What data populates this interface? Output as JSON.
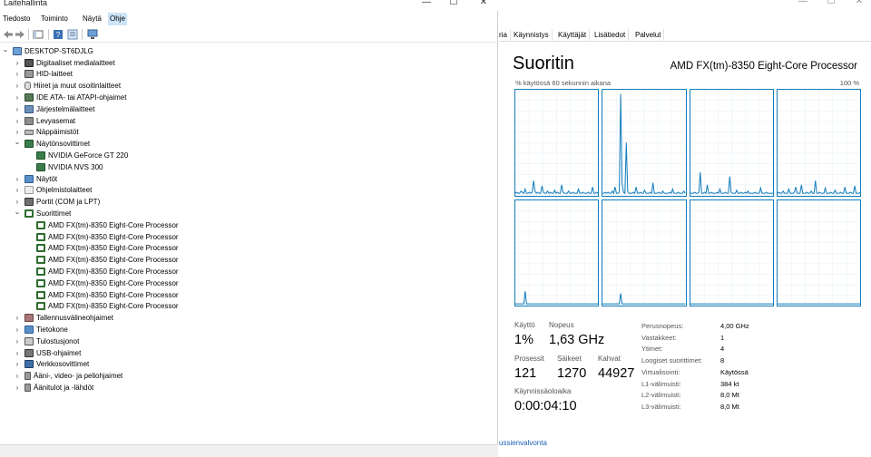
{
  "devmgr": {
    "title": "Laitehallinta",
    "menu": [
      "Tiedosto",
      "Toiminto",
      "Näytä",
      "Ohje"
    ],
    "tree": [
      {
        "label": "DESKTOP-ST6DJLG",
        "level": 0,
        "expander": "open",
        "icon": "pc"
      },
      {
        "label": "Digitaaliset medialaitteet",
        "level": 1,
        "expander": "closed",
        "icon": "media"
      },
      {
        "label": "HID-laitteet",
        "level": 1,
        "expander": "closed",
        "icon": "hid"
      },
      {
        "label": "Hiiret ja muut osoitinlaitteet",
        "level": 1,
        "expander": "closed",
        "icon": "mouse"
      },
      {
        "label": "IDE ATA- tai ATAPI-ohjaimet",
        "level": 1,
        "expander": "closed",
        "icon": "ide"
      },
      {
        "label": "Järjestelmälaitteet",
        "level": 1,
        "expander": "closed",
        "icon": "sys"
      },
      {
        "label": "Levyasemat",
        "level": 1,
        "expander": "closed",
        "icon": "disk"
      },
      {
        "label": "Näppäimistöt",
        "level": 1,
        "expander": "closed",
        "icon": "kbd"
      },
      {
        "label": "Näytönsovittimet",
        "level": 1,
        "expander": "open",
        "icon": "gpu"
      },
      {
        "label": "NVIDIA GeForce GT 220",
        "level": 2,
        "expander": "none",
        "icon": "gpu"
      },
      {
        "label": "NVIDIA NVS 300",
        "level": 2,
        "expander": "none",
        "icon": "gpu"
      },
      {
        "label": "Näytöt",
        "level": 1,
        "expander": "closed",
        "icon": "monitor"
      },
      {
        "label": "Ohjelmistolaitteet",
        "level": 1,
        "expander": "closed",
        "icon": "blank"
      },
      {
        "label": "Portit (COM ja LPT)",
        "level": 1,
        "expander": "closed",
        "icon": "port"
      },
      {
        "label": "Suorittimet",
        "level": 1,
        "expander": "open",
        "icon": "cpu"
      },
      {
        "label": "AMD FX(tm)-8350 Eight-Core Processor",
        "level": 2,
        "expander": "none",
        "icon": "cpu"
      },
      {
        "label": "AMD FX(tm)-8350 Eight-Core Processor",
        "level": 2,
        "expander": "none",
        "icon": "cpu"
      },
      {
        "label": "AMD FX(tm)-8350 Eight-Core Processor",
        "level": 2,
        "expander": "none",
        "icon": "cpu"
      },
      {
        "label": "AMD FX(tm)-8350 Eight-Core Processor",
        "level": 2,
        "expander": "none",
        "icon": "cpu"
      },
      {
        "label": "AMD FX(tm)-8350 Eight-Core Processor",
        "level": 2,
        "expander": "none",
        "icon": "cpu"
      },
      {
        "label": "AMD FX(tm)-8350 Eight-Core Processor",
        "level": 2,
        "expander": "none",
        "icon": "cpu"
      },
      {
        "label": "AMD FX(tm)-8350 Eight-Core Processor",
        "level": 2,
        "expander": "none",
        "icon": "cpu"
      },
      {
        "label": "AMD FX(tm)-8350 Eight-Core Processor",
        "level": 2,
        "expander": "none",
        "icon": "cpu"
      },
      {
        "label": "Tallennusvälineohjaimet",
        "level": 1,
        "expander": "closed",
        "icon": "storage"
      },
      {
        "label": "Tietokone",
        "level": 1,
        "expander": "closed",
        "icon": "monitor"
      },
      {
        "label": "Tulostusjonot",
        "level": 1,
        "expander": "closed",
        "icon": "print"
      },
      {
        "label": "USB-ohjaimet",
        "level": 1,
        "expander": "closed",
        "icon": "usb"
      },
      {
        "label": "Verkkosovittimet",
        "level": 1,
        "expander": "closed",
        "icon": "net"
      },
      {
        "label": "Ääni-, video- ja peliohjaimet",
        "level": 1,
        "expander": "closed",
        "icon": "sound"
      },
      {
        "label": "Äänitulot ja -lähdöt",
        "level": 1,
        "expander": "closed",
        "icon": "sound"
      }
    ]
  },
  "taskmgr": {
    "tabs": [
      "ria",
      "Käynnistys",
      "Käyttäjät",
      "Lisätiedot",
      "Palvelut"
    ],
    "heading": "Suoritin",
    "cpu_name": "AMD FX(tm)-8350 Eight-Core Processor",
    "graph_label_left": "% käytössä 60 sekunnin aikana",
    "graph_label_right": "100 %",
    "stats": {
      "usage_label": "Käyttö",
      "usage_value": "1%",
      "speed_label": "Nopeus",
      "speed_value": "1,63 GHz",
      "processes_label": "Prosessit",
      "processes_value": "121",
      "threads_label": "Säikeet",
      "threads_value": "1270",
      "handles_label": "Kahvat",
      "handles_value": "44927",
      "uptime_label": "Käynnissäoloaika",
      "uptime_value": "0:00:04:10"
    },
    "info": [
      {
        "label": "Perusnopeus:",
        "value": "4,00 GHz"
      },
      {
        "label": "Vastakkeet:",
        "value": "1"
      },
      {
        "label": "Ytimet:",
        "value": "4"
      },
      {
        "label": "Loogiset suorittimet:",
        "value": "8"
      },
      {
        "label": "Virtualisointi:",
        "value": "Käytössä"
      },
      {
        "label": "L1-välimuisti:",
        "value": "384 kt"
      },
      {
        "label": "L2-välimuisti:",
        "value": "8,0 Mt"
      },
      {
        "label": "L3-välimuisti:",
        "value": "8,0 Mt"
      }
    ],
    "footer_link": "ussienvalvonta",
    "line_color": "#117dbb",
    "fill_color": "#f1f6fa",
    "core_usage": [
      [
        2,
        3,
        2,
        2,
        4,
        3,
        2,
        6,
        2,
        2,
        3,
        2,
        3,
        14,
        4,
        2,
        3,
        2,
        2,
        9,
        3,
        2,
        2,
        4,
        2,
        3,
        2,
        2,
        5,
        2,
        3,
        2,
        2,
        10,
        3,
        2,
        2,
        2,
        4,
        2,
        2,
        3,
        2,
        2,
        2,
        6,
        2,
        2,
        3,
        2,
        2,
        2,
        3,
        2,
        2,
        8,
        2,
        2,
        3,
        2
      ],
      [
        2,
        2,
        3,
        2,
        3,
        2,
        2,
        4,
        2,
        8,
        2,
        2,
        3,
        96,
        12,
        3,
        2,
        50,
        4,
        2,
        2,
        2,
        3,
        2,
        8,
        2,
        2,
        3,
        2,
        2,
        5,
        2,
        2,
        2,
        3,
        2,
        12,
        2,
        2,
        2,
        3,
        2,
        2,
        4,
        2,
        2,
        2,
        2,
        3,
        2,
        6,
        2,
        2,
        2,
        3,
        2,
        2,
        2,
        4,
        2
      ],
      [
        2,
        2,
        2,
        3,
        2,
        2,
        3,
        22,
        2,
        2,
        3,
        2,
        10,
        2,
        2,
        3,
        2,
        2,
        2,
        3,
        2,
        6,
        2,
        2,
        2,
        3,
        2,
        2,
        18,
        3,
        2,
        2,
        2,
        5,
        2,
        2,
        3,
        2,
        2,
        3,
        2,
        4,
        2,
        2,
        2,
        2,
        3,
        2,
        2,
        2,
        7,
        2,
        2,
        2,
        3,
        2,
        2,
        2,
        2,
        2
      ],
      [
        2,
        3,
        2,
        2,
        4,
        2,
        2,
        2,
        6,
        2,
        2,
        2,
        3,
        8,
        2,
        2,
        2,
        10,
        2,
        2,
        2,
        3,
        2,
        2,
        4,
        2,
        2,
        14,
        2,
        2,
        3,
        2,
        2,
        2,
        7,
        2,
        2,
        2,
        3,
        2,
        2,
        5,
        2,
        2,
        2,
        3,
        2,
        2,
        8,
        2,
        2,
        2,
        3,
        2,
        2,
        9,
        2,
        2,
        2,
        3
      ],
      [
        2,
        2,
        2,
        2,
        2,
        2,
        2,
        14,
        2,
        2,
        2,
        2,
        2,
        2,
        2,
        2,
        2,
        2,
        2,
        2,
        2,
        2,
        2,
        2,
        2,
        2,
        2,
        2,
        2,
        2,
        2,
        2,
        2,
        2,
        2,
        2,
        2,
        2,
        2,
        2,
        2,
        2,
        2,
        2,
        2,
        2,
        2,
        2,
        2,
        2,
        2,
        2,
        2,
        2,
        2,
        2,
        2,
        2,
        2,
        2
      ],
      [
        2,
        2,
        2,
        2,
        2,
        2,
        2,
        2,
        2,
        2,
        2,
        2,
        2,
        12,
        2,
        2,
        2,
        2,
        2,
        2,
        2,
        2,
        2,
        2,
        2,
        2,
        2,
        2,
        2,
        2,
        2,
        2,
        2,
        2,
        2,
        2,
        2,
        2,
        2,
        2,
        2,
        2,
        2,
        2,
        2,
        2,
        2,
        2,
        2,
        2,
        2,
        2,
        2,
        2,
        2,
        2,
        2,
        2,
        2,
        2
      ],
      [
        2,
        2,
        2,
        2,
        2,
        2,
        2,
        2,
        2,
        2,
        2,
        2,
        2,
        2,
        2,
        2,
        2,
        2,
        2,
        2,
        2,
        2,
        2,
        2,
        2,
        2,
        2,
        2,
        2,
        2,
        2,
        2,
        2,
        2,
        2,
        2,
        2,
        2,
        2,
        2,
        2,
        2,
        2,
        2,
        2,
        2,
        2,
        2,
        2,
        2,
        2,
        2,
        2,
        2,
        2,
        2,
        2,
        2,
        2,
        2
      ],
      [
        2,
        2,
        2,
        2,
        2,
        2,
        2,
        2,
        2,
        2,
        2,
        2,
        2,
        2,
        2,
        2,
        2,
        2,
        2,
        2,
        2,
        2,
        2,
        2,
        2,
        2,
        2,
        2,
        2,
        2,
        2,
        2,
        2,
        2,
        2,
        2,
        2,
        2,
        2,
        2,
        2,
        2,
        2,
        2,
        2,
        2,
        2,
        2,
        2,
        2,
        2,
        2,
        2,
        2,
        2,
        2,
        2,
        2,
        2,
        2
      ]
    ]
  }
}
